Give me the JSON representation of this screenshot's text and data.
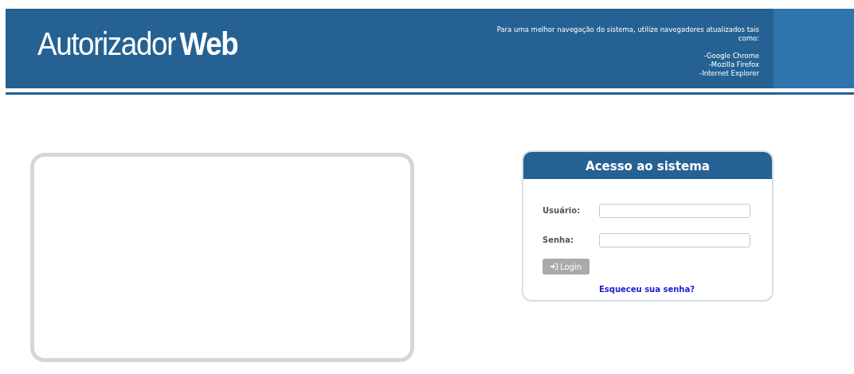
{
  "header": {
    "brand": "Autorizador**Web**",
    "note": "Para uma melhor navegação do sistema, utilize navegadores atualizados tais como:",
    "browsers": [
      "-Google Chrome",
      "-Mozilla Firefox",
      "-Internet Explorer"
    ]
  },
  "login": {
    "title": "Acesso ao sistema",
    "fields": [
      {
        "label": "Usuário:"
      },
      {
        "label": "Senha:"
      }
    ],
    "button": {
      "label": "Login",
      "disabled": true
    },
    "forgot_link": "Esqueceu sua senha?"
  }
}
